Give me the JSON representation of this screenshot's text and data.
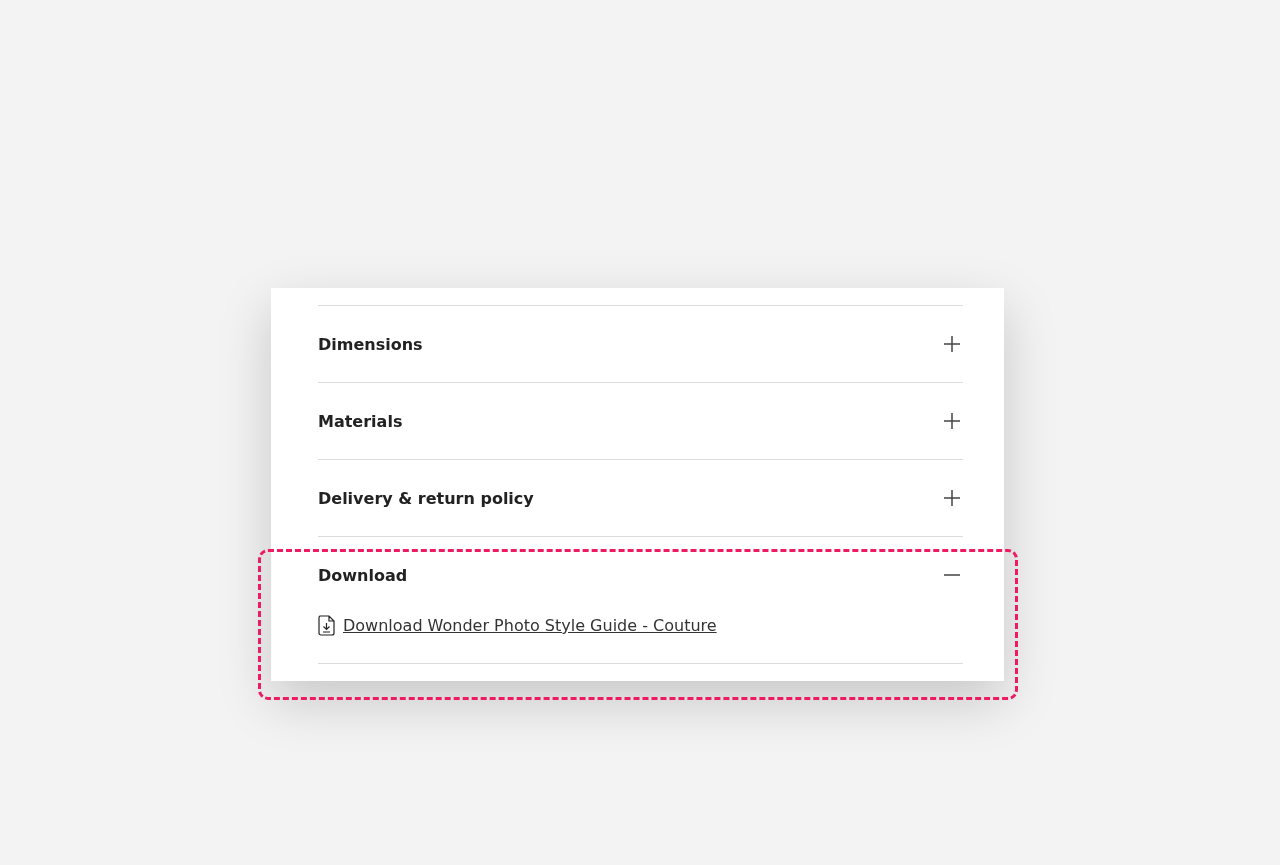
{
  "accordion": [
    {
      "title": "Dimensions",
      "expanded": false,
      "highlighted": false
    },
    {
      "title": "Materials",
      "expanded": false,
      "highlighted": false
    },
    {
      "title": "Delivery & return policy",
      "expanded": false,
      "highlighted": false
    },
    {
      "title": "Download",
      "expanded": true,
      "highlighted": true,
      "links": [
        "Download Wonder Photo Style Guide - Couture"
      ]
    }
  ]
}
